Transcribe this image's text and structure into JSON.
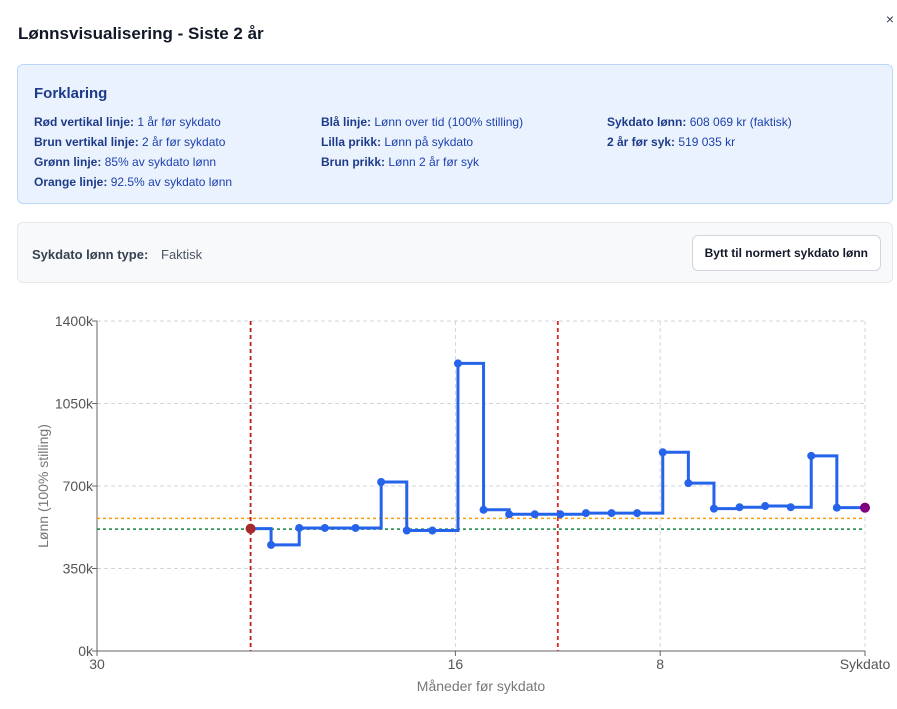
{
  "modal": {
    "title": "Lønnsvisualisering - Siste 2 år",
    "close_symbol": "×"
  },
  "legend": {
    "title": "Forklaring",
    "col1": [
      {
        "key": "Rød vertikal linje:",
        "value": "1 år før sykdato"
      },
      {
        "key": "Brun vertikal linje:",
        "value": "2 år før sykdato"
      },
      {
        "key": "Grønn linje:",
        "value": "85% av sykdato lønn"
      },
      {
        "key": "Orange linje:",
        "value": "92.5% av sykdato lønn"
      }
    ],
    "col2": [
      {
        "key": "Blå linje:",
        "value": "Lønn over tid (100% stilling)"
      },
      {
        "key": "Lilla prikk:",
        "value": "Lønn på sykdato"
      },
      {
        "key": "Brun prikk:",
        "value": "Lønn 2 år før syk"
      }
    ],
    "col3": [
      {
        "key": "Sykdato lønn:",
        "value": "608 069 kr (faktisk)"
      },
      {
        "key": "2 år før syk:",
        "value": "519 035 kr"
      }
    ]
  },
  "salary_type": {
    "label": "Sykdato lønn type:",
    "value": "Faktisk",
    "button_label": "Bytt til normert sykdato lønn"
  },
  "chart_data": {
    "type": "line",
    "step": true,
    "xlabel": "Måneder før sykdato",
    "ylabel": "Lønn (100% stilling)",
    "xlim": [
      30,
      0
    ],
    "ylim": [
      0,
      1400000
    ],
    "x_ticks": [
      {
        "value": 30,
        "label": "30"
      },
      {
        "value": 16,
        "label": "16"
      },
      {
        "value": 8,
        "label": "8"
      },
      {
        "value": 0,
        "label": "Sykdato"
      }
    ],
    "y_ticks": [
      {
        "value": 0,
        "label": "0k"
      },
      {
        "value": 350000,
        "label": "350k"
      },
      {
        "value": 700000,
        "label": "700k"
      },
      {
        "value": 1050000,
        "label": "1050k"
      },
      {
        "value": 1400000,
        "label": "1400k"
      }
    ],
    "grid": true,
    "series": [
      {
        "points": [
          [
            24,
            519000
          ],
          [
            23.2,
            450000
          ],
          [
            22.1,
            522000
          ],
          [
            21.1,
            522000
          ],
          [
            19.9,
            522000
          ],
          [
            18.9,
            717000
          ],
          [
            17.9,
            511000
          ],
          [
            16.9,
            511000
          ],
          [
            15.9,
            1220000
          ],
          [
            14.9,
            599000
          ],
          [
            13.9,
            580000
          ],
          [
            12.9,
            580000
          ],
          [
            11.9,
            580000
          ],
          [
            10.9,
            585000
          ],
          [
            9.9,
            585000
          ],
          [
            8.9,
            585000
          ],
          [
            7.9,
            843000
          ],
          [
            6.9,
            712000
          ],
          [
            5.9,
            604000
          ],
          [
            4.9,
            610000
          ],
          [
            3.9,
            615000
          ],
          [
            2.9,
            610000
          ],
          [
            2.1,
            828000
          ],
          [
            1.1,
            608069
          ],
          [
            0,
            608069
          ]
        ],
        "color": "#2563eb"
      }
    ],
    "reference_lines": {
      "horizontal": [
        {
          "value": 562464,
          "color": "#f59e0b"
        },
        {
          "value": 516859,
          "color": "#15803d"
        }
      ],
      "vertical": [
        {
          "value": 24,
          "color": "#b91c1c"
        },
        {
          "value": 12,
          "color": "#dc2626"
        }
      ]
    },
    "markers": {
      "brown_point": {
        "x": 24,
        "y": 519035,
        "color": "#a52a2a"
      },
      "purple_point": {
        "x": 0,
        "y": 608069,
        "color": "#800080"
      }
    }
  }
}
